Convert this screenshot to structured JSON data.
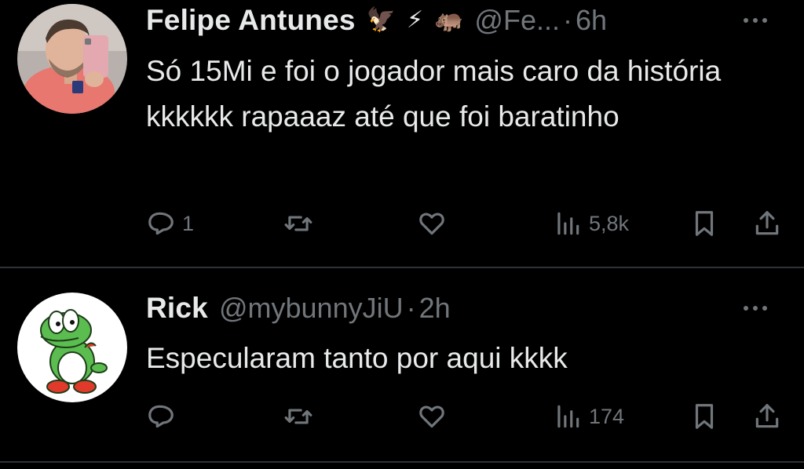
{
  "tweets": [
    {
      "name": "Felipe Antunes",
      "badges": [
        "eagle-emoji",
        "lightning-emoji",
        "hippo-emoji"
      ],
      "badge_glyphs": [
        "🦅",
        "⚡",
        "🦛"
      ],
      "handle": "@Fe...",
      "separator": "·",
      "time": "6h",
      "text": "Só 15Mi e foi o jogador mais caro da história kkkkkk rapaaaz até que foi baratinho",
      "replies": "1",
      "retweets": "",
      "likes": "",
      "views": "5,8k"
    },
    {
      "name": "Rick",
      "badges": [],
      "badge_glyphs": [],
      "handle": "@mybunnyJiU",
      "separator": "·",
      "time": "2h",
      "text": "Especularam tanto por aqui kkkk",
      "replies": "",
      "retweets": "",
      "likes": "",
      "views": "174"
    }
  ],
  "colors": {
    "background": "#000000",
    "text_primary": "#e7e9ea",
    "text_secondary": "#71767b",
    "divider": "#2f3336"
  },
  "icons": [
    "reply-icon",
    "retweet-icon",
    "like-icon",
    "views-icon",
    "bookmark-icon",
    "share-icon",
    "more-icon"
  ]
}
